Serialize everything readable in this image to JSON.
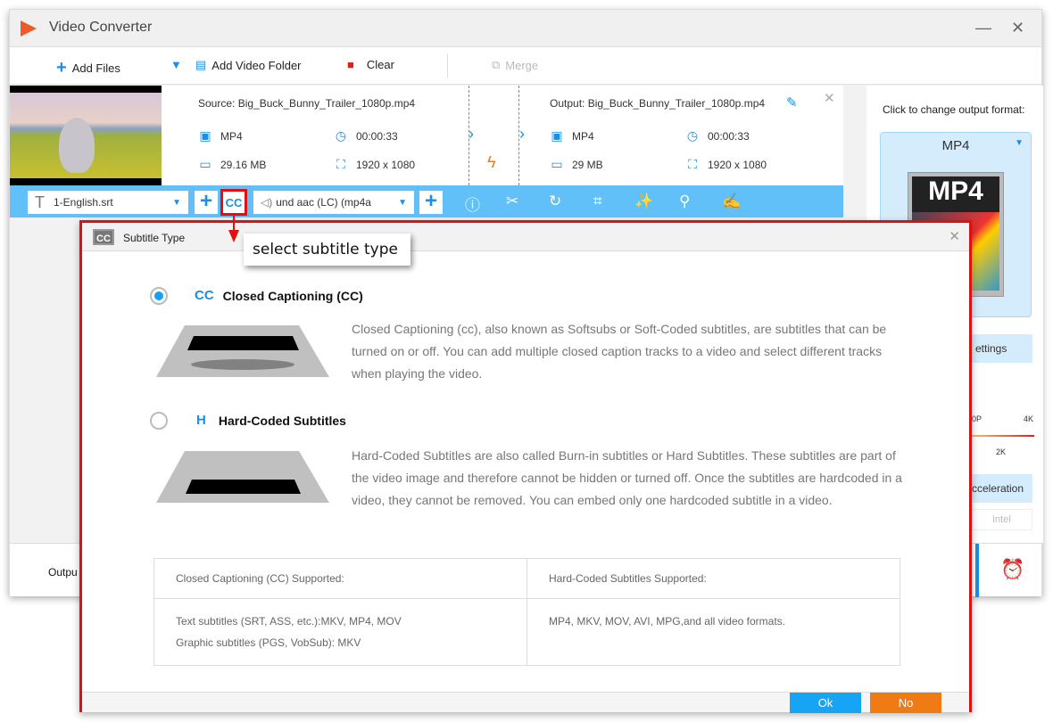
{
  "window": {
    "title": "Video Converter"
  },
  "toolbar": {
    "add_files": "Add Files",
    "add_folder": "Add Video Folder",
    "clear": "Clear",
    "merge": "Merge"
  },
  "source": {
    "name": "Source: Big_Buck_Bunny_Trailer_1080p.mp4",
    "format": "MP4",
    "duration": "00:00:33",
    "size": "29.16 MB",
    "resolution": "1920 x 1080"
  },
  "output": {
    "name": "Output: Big_Buck_Bunny_Trailer_1080p.mp4",
    "format": "MP4",
    "duration": "00:00:33",
    "size": "29 MB",
    "resolution": "1920 x 1080"
  },
  "edit_bar": {
    "subtitle": "1-English.srt",
    "audio": "und aac (LC) (mp4a"
  },
  "right_panel": {
    "hint": "Click to change output format:",
    "format": "MP4",
    "format_art": "MP4",
    "settings": "ettings",
    "res_low": "0P",
    "res_mid": "2K",
    "res_high": "4K",
    "accel": "cceleration",
    "intel": "Intel"
  },
  "bottom": {
    "output_label": "Outpu"
  },
  "annotation": {
    "tooltip": "select subtitle type"
  },
  "dialog": {
    "title": "Subtitle Type",
    "cc_icon": "CC",
    "options": [
      {
        "icon": "CC",
        "title": "Closed Captioning (CC)",
        "selected": true,
        "desc": "Closed Captioning (cc), also known as Softsubs or Soft-Coded subtitles, are subtitles that can be turned on or off. You can add multiple closed caption tracks to a video and select different tracks when playing the video."
      },
      {
        "icon": "H",
        "title": "Hard-Coded Subtitles",
        "selected": false,
        "desc": "Hard-Coded Subtitles are also called Burn-in subtitles or Hard Subtitles. These subtitles are part of the video image and therefore cannot be hidden or turned off. Once the subtitles are hardcoded in a video, they cannot be removed. You can embed only one hardcoded subtitle in a video."
      }
    ],
    "table": {
      "cc_header": "Closed Captioning (CC) Supported:",
      "hc_header": "Hard-Coded Subtitles Supported:",
      "cc_line1": "Text subtitles (SRT, ASS, etc.):MKV, MP4, MOV",
      "cc_line2": "Graphic subtitles (PGS, VobSub): MKV",
      "hc_line1": "MP4, MKV, MOV, AVI, MPG,and all video formats."
    },
    "ok": "Ok",
    "no": "No"
  },
  "colors": {
    "accent": "#1a8fe3",
    "bar": "#62c0f8",
    "highlight": "#e01010",
    "ok": "#16a4f5",
    "no": "#f07a14"
  }
}
